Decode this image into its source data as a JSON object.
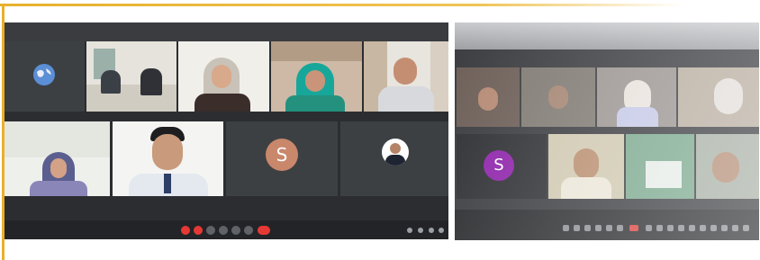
{
  "meeting_a": {
    "tiles": [
      {
        "name": "",
        "initial": ""
      },
      {
        "name": "",
        "initial": ""
      },
      {
        "name": "",
        "initial": ""
      },
      {
        "name": "",
        "initial": ""
      },
      {
        "name": "",
        "initial": ""
      },
      {
        "name": "",
        "initial": ""
      },
      {
        "name": "",
        "initial": ""
      },
      {
        "name": "",
        "initial": "S"
      },
      {
        "name": "",
        "initial": ""
      }
    ],
    "meeting_code": ""
  },
  "meeting_b": {
    "avatar_initial": "S"
  },
  "colors": {
    "frame_accent": "#e7b12d",
    "leave_button": "#e53935",
    "avatar_a": "#c9876b",
    "avatar_b": "#8e24aa"
  },
  "icons": [
    "globe-icon",
    "microphone-icon",
    "camera-icon",
    "captions-icon",
    "raise-hand-icon",
    "present-icon",
    "more-icon",
    "leave-call-icon",
    "info-icon",
    "people-icon",
    "chat-icon",
    "activities-icon"
  ]
}
